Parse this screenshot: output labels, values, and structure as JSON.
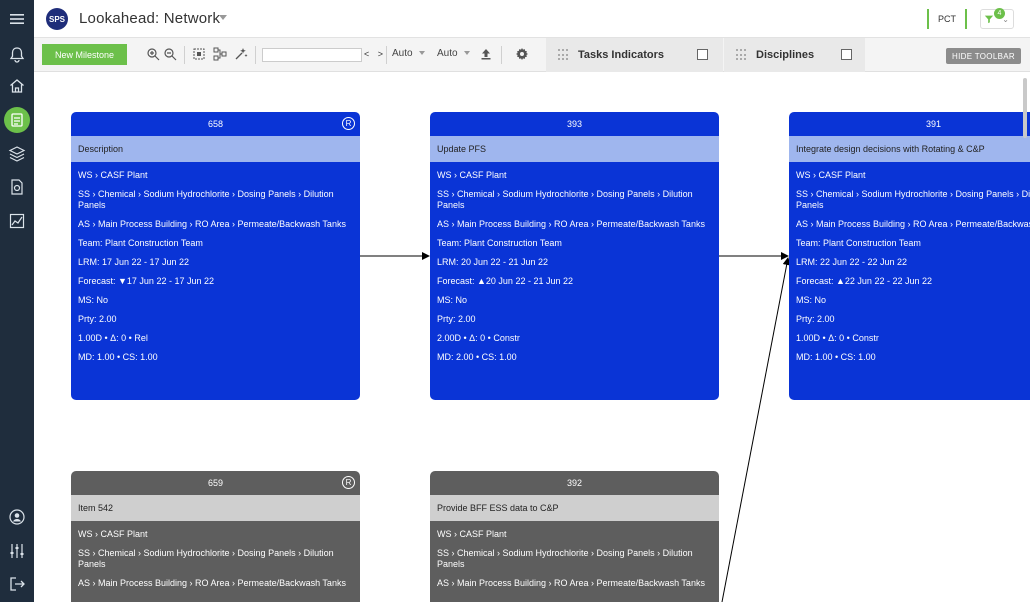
{
  "header": {
    "logo": "SPS",
    "title": "Lookahead: Network",
    "pct": "PCT",
    "filter_count": "4"
  },
  "toolbar": {
    "new_milestone": "New Milestone",
    "search_value": "",
    "nav_arrows": "< >",
    "zoom_select_1": "Auto",
    "zoom_select_2": "Auto",
    "tasks_indicators": "Tasks Indicators",
    "disciplines": "Disciplines",
    "hide_toolbar": "HIDE TOOLBAR"
  },
  "cards": [
    {
      "id": "658",
      "badge": "R",
      "description": "Description",
      "ws": "WS › CASF Plant",
      "ss": "SS › Chemical › Sodium Hydrochlorite › Dosing Panels › Dilution Panels",
      "as": "AS › Main Process Building › RO Area › Permeate/Backwash Tanks",
      "team": "Team: Plant Construction Team",
      "lrm": "LRM: 17 Jun 22 - 17 Jun 22",
      "forecast": "Forecast: ▼17 Jun 22 - 17 Jun 22",
      "ms": "MS: No",
      "prty": "Prty: 2.00",
      "dur": "1.00D • Δ: 0 • Rel",
      "md": "MD: 1.00 • CS: 1.00"
    },
    {
      "id": "393",
      "badge": "",
      "description": "Update PFS",
      "ws": "WS › CASF Plant",
      "ss": "SS › Chemical › Sodium Hydrochlorite › Dosing Panels › Dilution Panels",
      "as": "AS › Main Process Building › RO Area › Permeate/Backwash Tanks",
      "team": "Team: Plant Construction Team",
      "lrm": "LRM: 20 Jun 22 - 21 Jun 22",
      "forecast": "Forecast: ▲20 Jun 22 - 21 Jun 22",
      "ms": "MS: No",
      "prty": "Prty: 2.00",
      "dur": "2.00D • Δ: 0 • Constr",
      "md": "MD: 2.00 • CS: 1.00"
    },
    {
      "id": "391",
      "badge": "",
      "description": "Integrate design decisions with Rotating & C&P",
      "ws": "WS › CASF Plant",
      "ss": "SS › Chemical › Sodium Hydrochlorite › Dosing Panels › Dilution Panels",
      "as": "AS › Main Process Building › RO Area › Permeate/Backwash Tanks",
      "team": "Team: Plant Construction Team",
      "lrm": "LRM: 22 Jun 22 - 22 Jun 22",
      "forecast": "Forecast: ▲22 Jun 22 - 22 Jun 22",
      "ms": "MS: No",
      "prty": "Prty: 2.00",
      "dur": "1.00D • Δ: 0 • Constr",
      "md": "MD: 1.00 • CS: 1.00"
    },
    {
      "id": "659",
      "badge": "R",
      "description": "Item 542",
      "ws": "WS › CASF Plant",
      "ss": "SS › Chemical › Sodium Hydrochlorite › Dosing Panels › Dilution Panels",
      "as": "AS › Main Process Building › RO Area › Permeate/Backwash Tanks"
    },
    {
      "id": "392",
      "badge": "",
      "description": "Provide BFF ESS data to C&P",
      "ws": "WS › CASF Plant",
      "ss": "SS › Chemical › Sodium Hydrochlorite › Dosing Panels › Dilution Panels",
      "as": "AS › Main Process Building › RO Area › Permeate/Backwash Tanks"
    }
  ],
  "colors": {
    "rail": "#1f2d3d",
    "accent_green": "#6cc04a",
    "card_blue": "#0a34d6",
    "card_blue_desc": "#9fb6ee",
    "card_grey": "#5e5e5e",
    "card_grey_desc": "#cfcfcf"
  }
}
